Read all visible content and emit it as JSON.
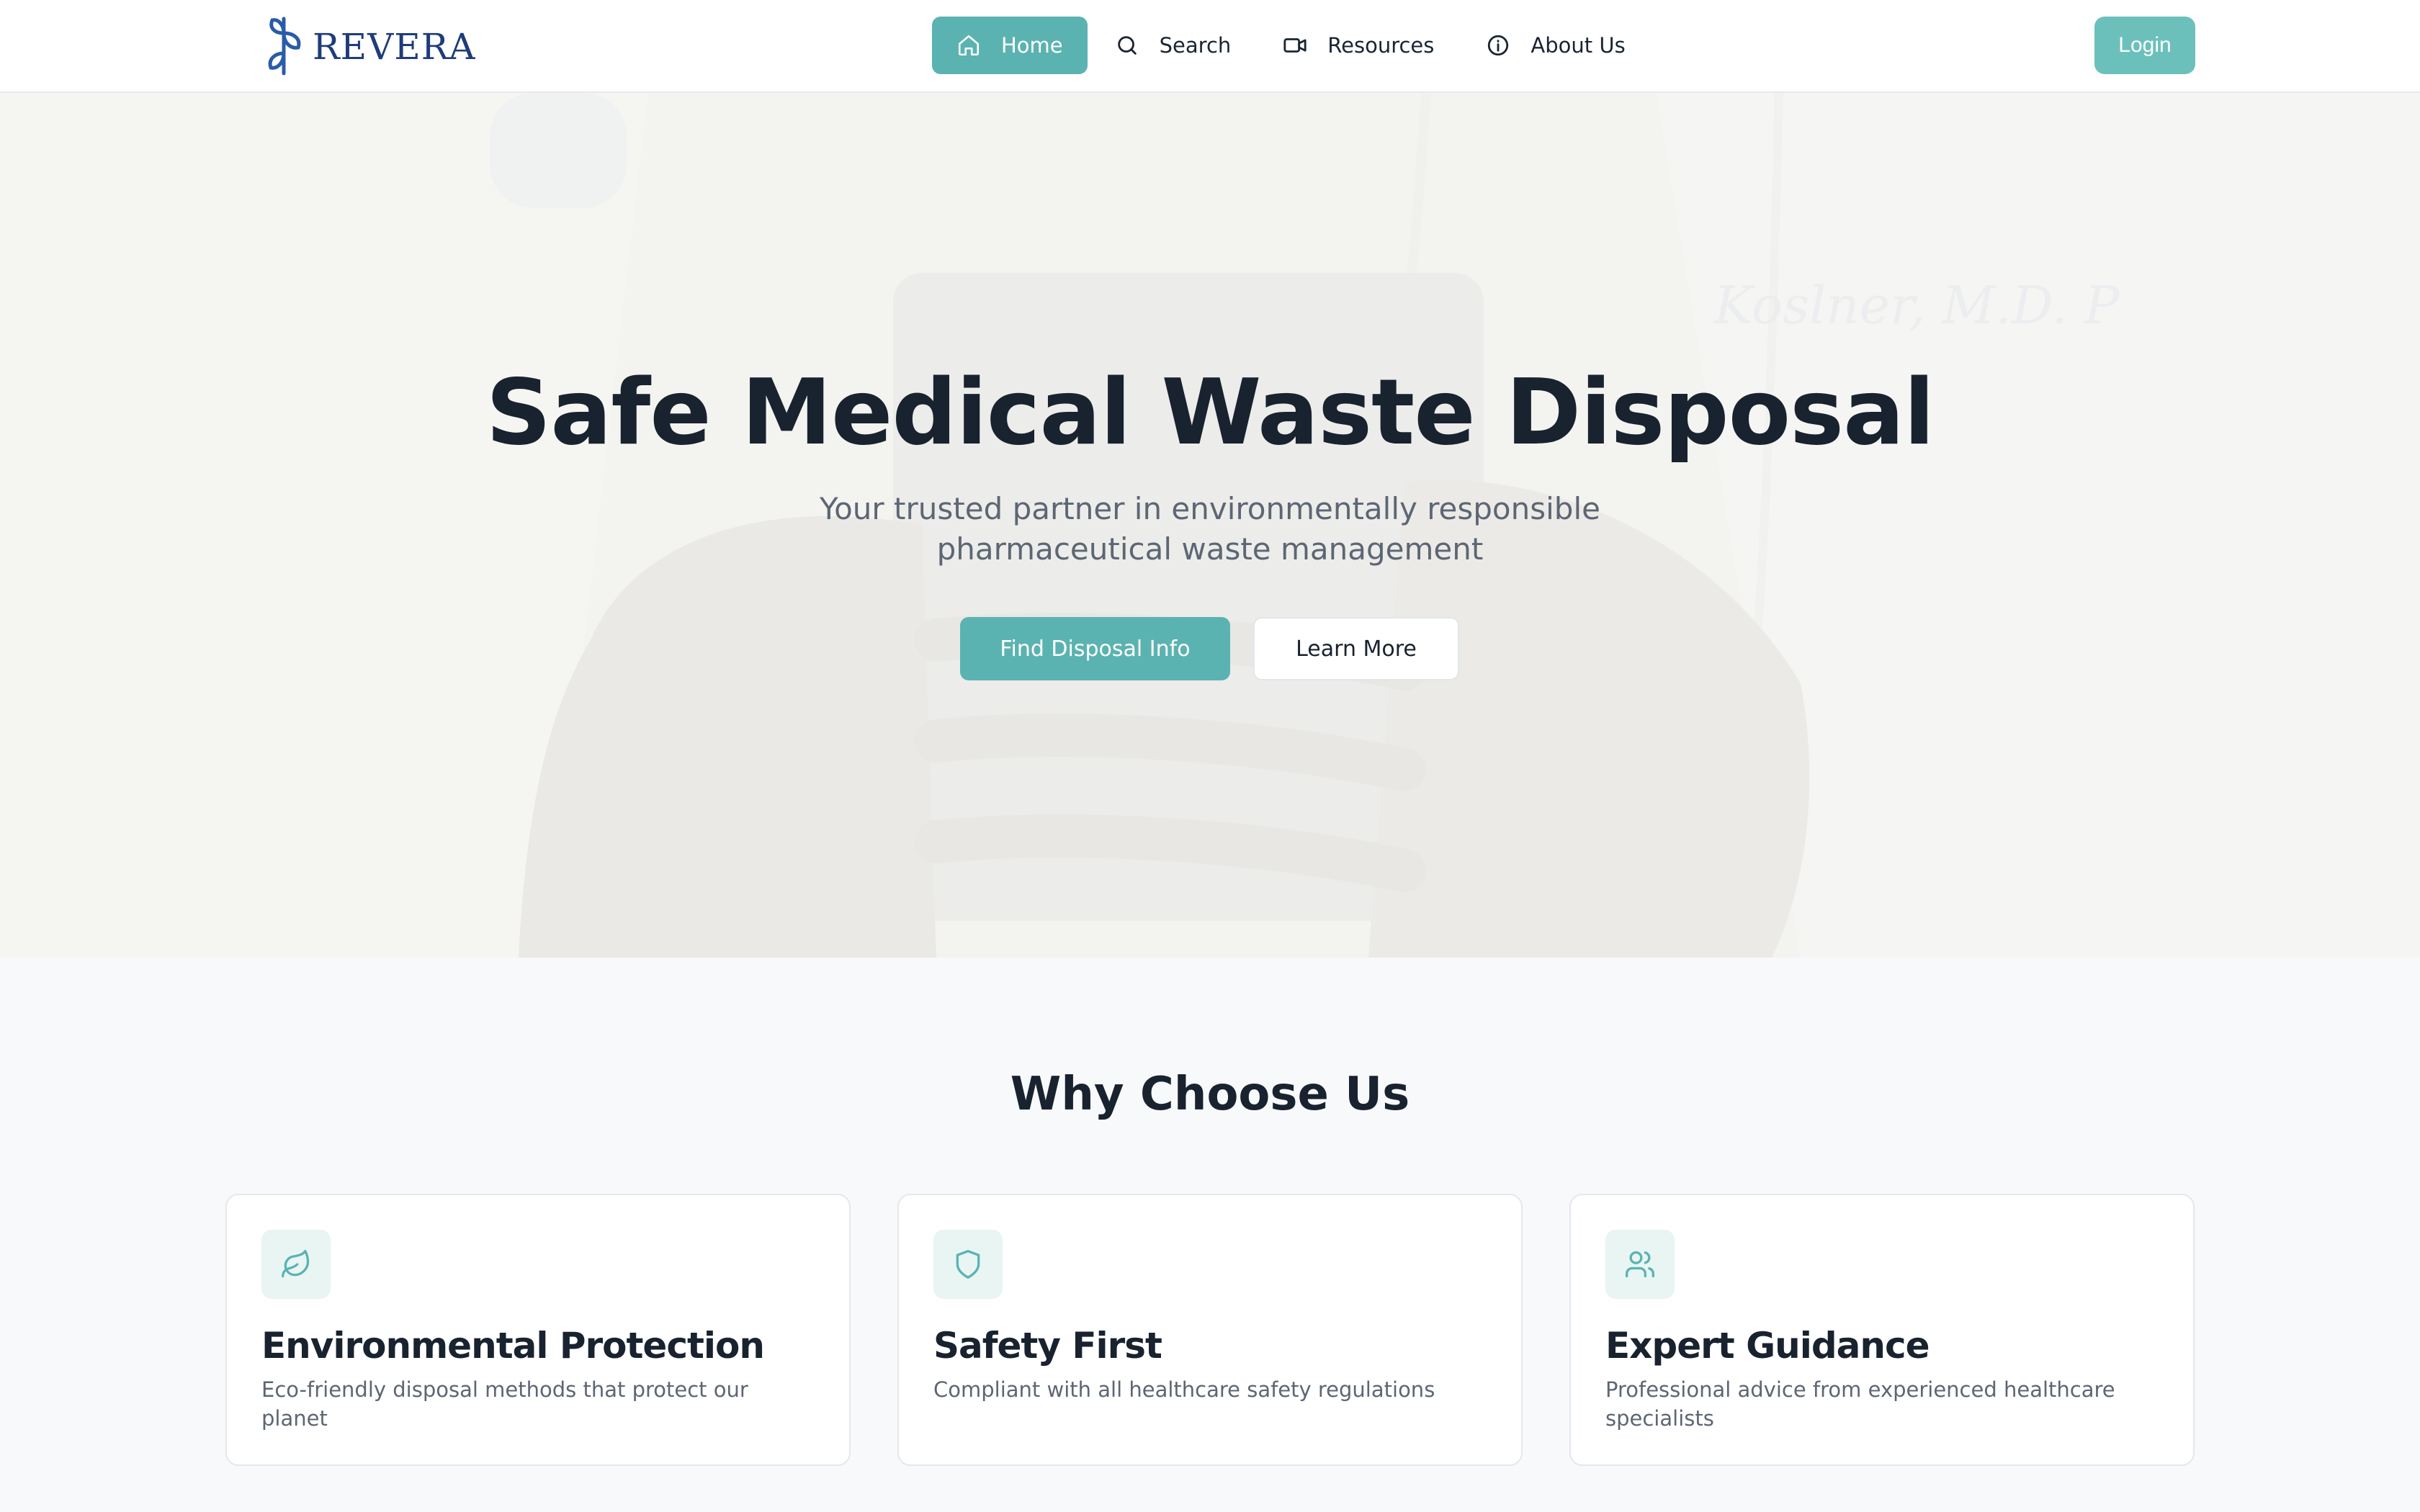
{
  "brand": {
    "name": "REVERA"
  },
  "nav": {
    "items": [
      {
        "label": "Home",
        "icon": "home-icon",
        "active": true
      },
      {
        "label": "Search",
        "icon": "search-icon",
        "active": false
      },
      {
        "label": "Resources",
        "icon": "video-icon",
        "active": false
      },
      {
        "label": "About Us",
        "icon": "info-icon",
        "active": false
      }
    ],
    "login_label": "Login"
  },
  "hero": {
    "title": "Safe Medical Waste Disposal",
    "subtitle": "Your trusted partner in environmentally responsible pharmaceutical waste management",
    "primary_button": "Find Disposal Info",
    "secondary_button": "Learn More"
  },
  "why": {
    "title": "Why Choose Us",
    "cards": [
      {
        "icon": "leaf-icon",
        "title": "Environmental Protection",
        "description": "Eco-friendly disposal methods that protect our planet"
      },
      {
        "icon": "shield-icon",
        "title": "Safety First",
        "description": "Compliant with all healthcare safety regulations"
      },
      {
        "icon": "users-icon",
        "title": "Expert Guidance",
        "description": "Professional advice from experienced healthcare specialists"
      }
    ]
  },
  "colors": {
    "accent": "#5bb3b1",
    "heading": "#19222f",
    "body_text": "#5d6673",
    "brand_blue": "#1f3c7a"
  }
}
